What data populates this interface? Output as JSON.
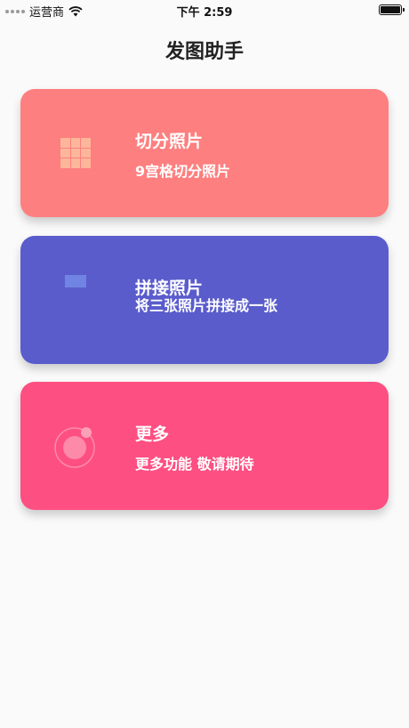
{
  "status_bar": {
    "carrier": "运营商",
    "time": "下午 2:59"
  },
  "nav": {
    "title": "发图助手"
  },
  "cards": [
    {
      "title": "切分照片",
      "subtitle": "9宫格切分照片",
      "icon": "grid-icon",
      "color": "#fe7f7f"
    },
    {
      "title": "拼接照片",
      "subtitle": "将三张照片拼接成一张",
      "icon": "collage-icon",
      "color": "#5a5ccc"
    },
    {
      "title": "更多",
      "subtitle": "更多功能 敬请期待",
      "icon": "orbit-icon",
      "color": "#fe4f82"
    }
  ]
}
